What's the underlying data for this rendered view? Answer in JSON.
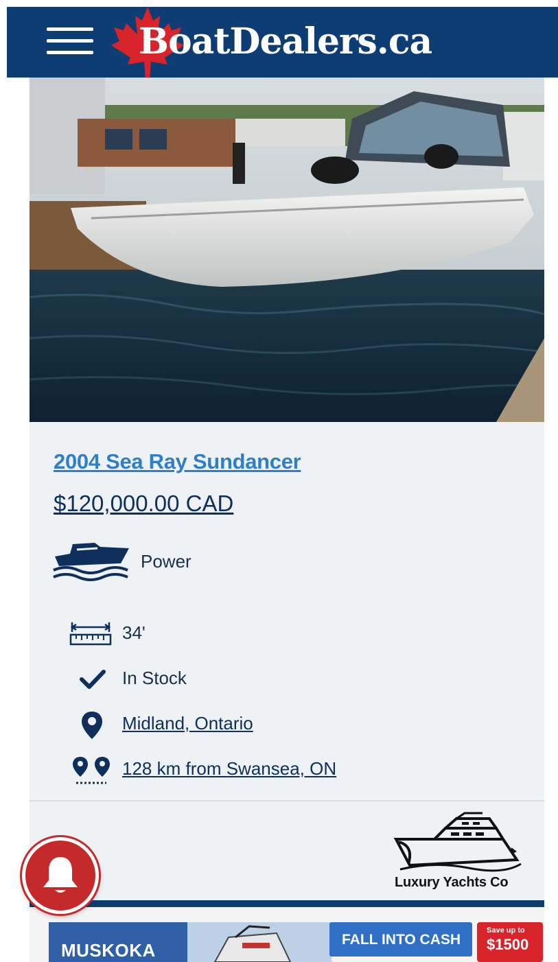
{
  "header": {
    "brand": "BoatDealers.ca",
    "menu_icon": "hamburger-menu-icon",
    "logo_icon": "maple-leaf-icon",
    "colors": {
      "bar": "#0e3d73",
      "leaf": "#d8232a"
    }
  },
  "listing": {
    "photo": "boat-listing-photo",
    "title": "2004 Sea Ray Sundancer",
    "price": "$120,000.00 CAD",
    "type": {
      "label": "Power",
      "icon": "power-boat-icon"
    },
    "specs": [
      {
        "icon": "length-ruler-icon",
        "text": "34'"
      },
      {
        "icon": "checkmark-icon",
        "text": "In Stock"
      },
      {
        "icon": "location-pin-icon",
        "text": "Midland, Ontario"
      },
      {
        "icon": "distance-pins-icon",
        "text": "128 km from Swansea, ON"
      }
    ],
    "dealer": {
      "name": "Luxury Yachts Co",
      "icon": "yacht-logo-icon"
    },
    "colors": {
      "title_link": "#2e7fc8",
      "text": "#0e2f5c",
      "card_bg": "#eef2f5"
    }
  },
  "notification": {
    "icon": "bell-icon",
    "color": "#c52a2a"
  },
  "ad": {
    "left_text": "MUSKOKA",
    "cta": "FALL INTO CASH",
    "badge_small": "Save up to",
    "badge_big": "$1500"
  }
}
